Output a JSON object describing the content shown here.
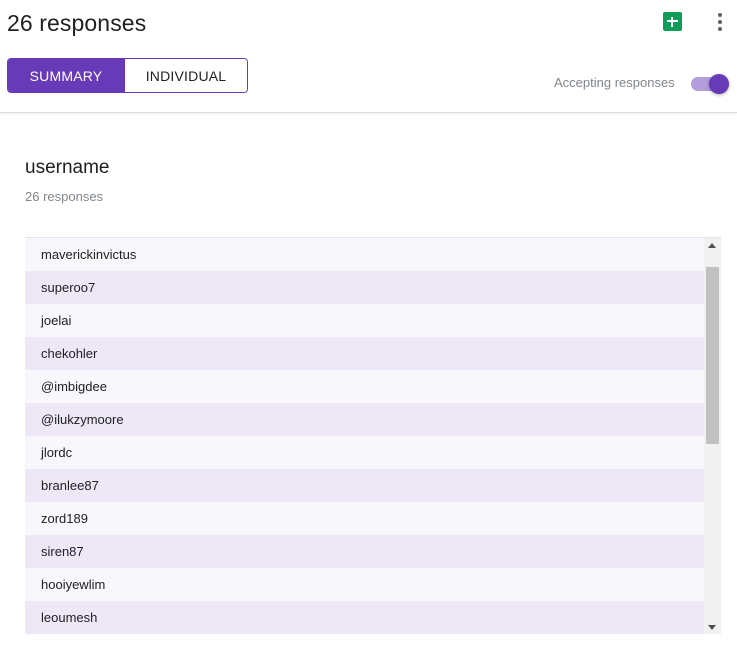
{
  "header": {
    "title": "26 responses",
    "tabs": [
      {
        "label": "SUMMARY",
        "active": true
      },
      {
        "label": "INDIVIDUAL",
        "active": false
      }
    ],
    "accepting_label": "Accepting responses",
    "accepting_on": true,
    "icons": {
      "sheets": "sheets-icon",
      "more": "more-vert-icon"
    }
  },
  "question": {
    "title": "username",
    "count_label": "26 responses",
    "responses": [
      "maverickinvictus",
      "superoo7",
      "joelai",
      "chekohler",
      "@imbigdee",
      "@ilukzymoore",
      "jlordc",
      "branlee87",
      "zord189",
      "siren87",
      "hooiyewlim",
      "leoumesh"
    ]
  },
  "colors": {
    "accent": "#673ab7",
    "accent_light": "#b39ddb",
    "row_alt": "#ede7f6",
    "row": "#f8f7fc",
    "sheets_green": "#0f9d58"
  }
}
